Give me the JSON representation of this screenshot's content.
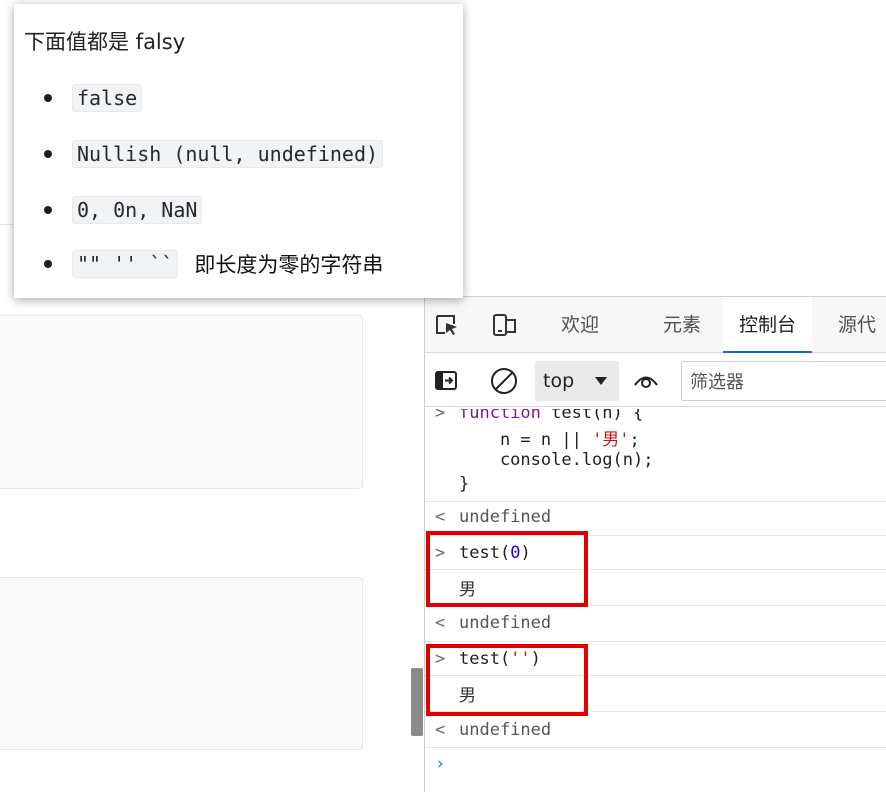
{
  "popup": {
    "title": "下面值都是 falsy",
    "items": [
      {
        "code": "false",
        "note": ""
      },
      {
        "code": "Nullish (null, undefined)",
        "note": ""
      },
      {
        "code": "0, 0n, NaN",
        "note": ""
      },
      {
        "code": "\"\" '' ``",
        "note": "即长度为零的字符串"
      }
    ]
  },
  "devtools": {
    "tabs": [
      {
        "label": "欢迎",
        "active": false
      },
      {
        "label": "元素",
        "active": false
      },
      {
        "label": "控制台",
        "active": true
      },
      {
        "label": "源代码",
        "active": false
      }
    ],
    "toolbar": {
      "context": "top",
      "filter_placeholder": "筛选器"
    },
    "console": {
      "function_lines": [
        "function test(n) {",
        "    n = n || '男';",
        "    console.log(n);",
        "}"
      ],
      "entries": [
        {
          "type": "result",
          "text": "undefined"
        },
        {
          "type": "input",
          "text": "test(0)",
          "arg": "0"
        },
        {
          "type": "log",
          "text": "男"
        },
        {
          "type": "result",
          "text": "undefined"
        },
        {
          "type": "input",
          "text": "test('')",
          "arg": "''"
        },
        {
          "type": "log",
          "text": "男"
        },
        {
          "type": "result",
          "text": "undefined"
        }
      ],
      "prompt": ""
    }
  },
  "colors": {
    "highlight_box": "#e00000",
    "active_tab_underline": "#0a6dd8",
    "keyword": "#881391",
    "string": "#c41a16",
    "number": "#1c00cf"
  }
}
